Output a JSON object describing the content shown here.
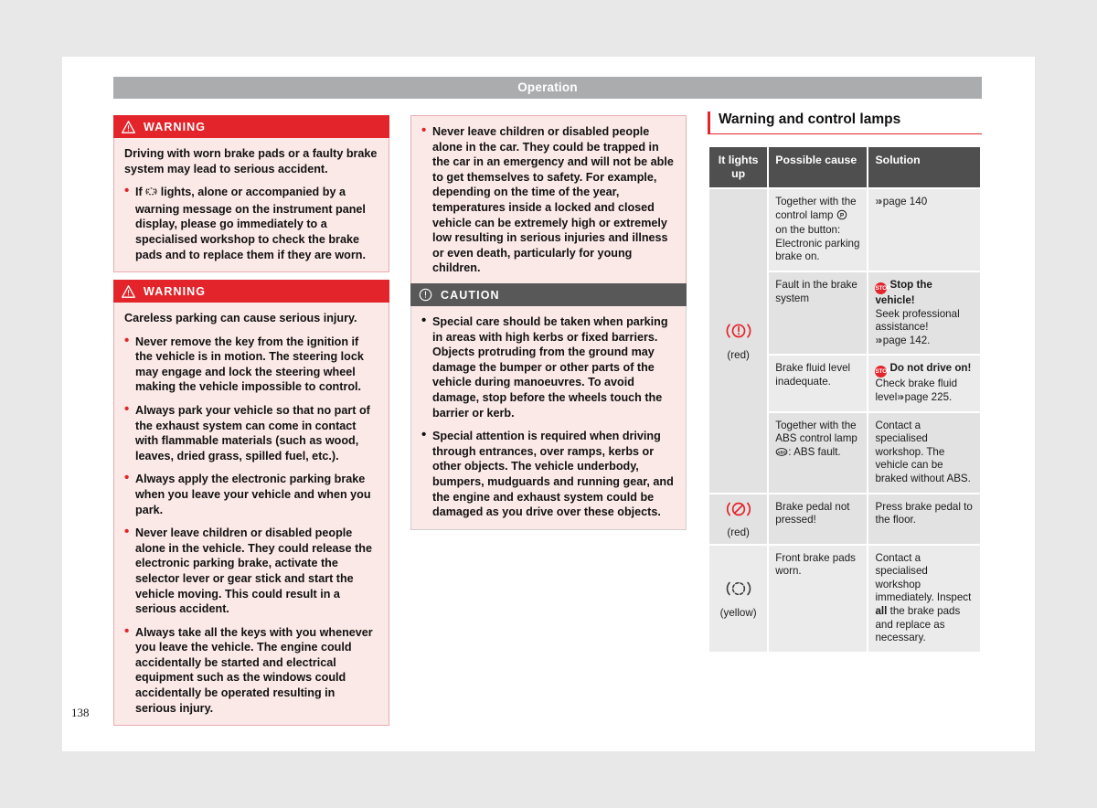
{
  "page": {
    "header_title": "Operation",
    "page_number": "138"
  },
  "warnings": [
    {
      "label": "WARNING",
      "icon": "warning-triangle-icon",
      "paragraphs": [
        {
          "bullet": false,
          "text": "Driving with worn brake pads or a faulty brake system may lead to serious accident."
        },
        {
          "bullet": true,
          "text_before": "If ",
          "inline_icon": "brake-pad-wear-lamp-icon",
          "text_after": " lights, alone or accompanied by a warning message on the instrument panel display, please go immediately to a specialised workshop to check the brake pads and to replace them if they are worn."
        }
      ]
    },
    {
      "label": "WARNING",
      "icon": "warning-triangle-icon",
      "paragraphs": [
        {
          "bullet": false,
          "text": "Careless parking can cause serious injury."
        },
        {
          "bullet": true,
          "text": "Never remove the key from the ignition if the vehicle is in motion. The steering lock may engage and lock the steering wheel making the vehicle impossible to control."
        },
        {
          "bullet": true,
          "text": "Always park your vehicle so that no part of the exhaust system can come in contact with flammable materials (such as wood, leaves, dried grass, spilled fuel, etc.)."
        },
        {
          "bullet": true,
          "text": "Always apply the electronic parking brake when you leave your vehicle and when you park."
        },
        {
          "bullet": true,
          "text": "Never leave children or disabled people alone in the vehicle. They could release the electronic parking brake, activate the selector lever or gear stick and start the vehicle moving. This could result in a serious accident."
        },
        {
          "bullet": true,
          "text": "Always take all the keys with you whenever you leave the vehicle. The engine could accidentally be started and electrical equipment such as the windows could accidentally be operated resulting in serious injury."
        }
      ]
    }
  ],
  "middle_column": {
    "continued_warning": {
      "paragraphs": [
        {
          "bullet": true,
          "text": "Never leave children or disabled people alone in the car. They could be trapped in the car in an emergency and will not be able to get themselves to safety. For example, depending on the time of the year, temperatures inside a locked and closed vehicle can be extremely high or extremely low resulting in serious injuries and illness or even death, particularly for young children."
        }
      ]
    },
    "caution": {
      "label": "CAUTION",
      "icon": "caution-exclamation-icon",
      "paragraphs": [
        {
          "bullet": true,
          "text": "Special care should be taken when parking in areas with high kerbs or fixed barriers. Objects protruding from the ground may damage the bumper or other parts of the vehicle during manoeuvres. To avoid damage, stop before the wheels touch the barrier or kerb."
        },
        {
          "bullet": true,
          "text": "Special attention is required when driving through entrances, over ramps, kerbs or other objects. The vehicle underbody, bumpers, mudguards and running gear, and the engine and exhaust system could be damaged as you drive over these objects."
        }
      ]
    }
  },
  "lamps_section": {
    "title": "Warning and control lamps",
    "columns": [
      "It lights up",
      "Possible cause",
      "Solution"
    ],
    "groups": [
      {
        "symbol": "brake-warning-lamp-icon",
        "symbol_color_label": "(red)",
        "rows": [
          {
            "cause_before": "Together with the control lamp ",
            "cause_icon": "parking-brake-p-icon",
            "cause_after": " on the button: Electronic parking brake on.",
            "solution_link": "page 140",
            "solution_text": ""
          },
          {
            "cause": "Fault in the brake system",
            "solution_badge": "STOP",
            "solution_bold": "Stop the vehicle!",
            "solution_text": "Seek professional assistance!",
            "solution_link": "page 142."
          },
          {
            "cause": "Brake fluid level inadequate.",
            "solution_badge": "STOP",
            "solution_bold": "Do not drive on!",
            "solution_text": "Check brake fluid level",
            "solution_link": "page 225."
          },
          {
            "cause_before": "Together with the ABS control lamp ",
            "cause_icon": "abs-lamp-icon",
            "cause_after": ": ABS fault.",
            "solution_text": "Contact a specialised workshop. The vehicle can be braked without ABS."
          }
        ]
      },
      {
        "symbol": "brake-pedal-not-pressed-icon",
        "symbol_color_label": "(red)",
        "rows": [
          {
            "cause": "Brake pedal not pressed!",
            "solution_text": "Press brake pedal to the floor."
          }
        ]
      },
      {
        "symbol": "brake-pad-wear-lamp-icon",
        "symbol_color_label": "(yellow)",
        "rows": [
          {
            "cause": "Front brake pads worn.",
            "solution_before": "Contact a specialised workshop immediately. Inspect ",
            "solution_bold_inline": "all",
            "solution_after": " the brake pads and replace as necessary."
          }
        ]
      }
    ]
  },
  "colors": {
    "warning_red": "#e3242b",
    "caution_grey": "#585858",
    "header_band": "#aaacae",
    "table_header": "#4f4f4f",
    "warning_body_bg": "#fbe9e7",
    "page_bg": "#e8e8e8"
  }
}
